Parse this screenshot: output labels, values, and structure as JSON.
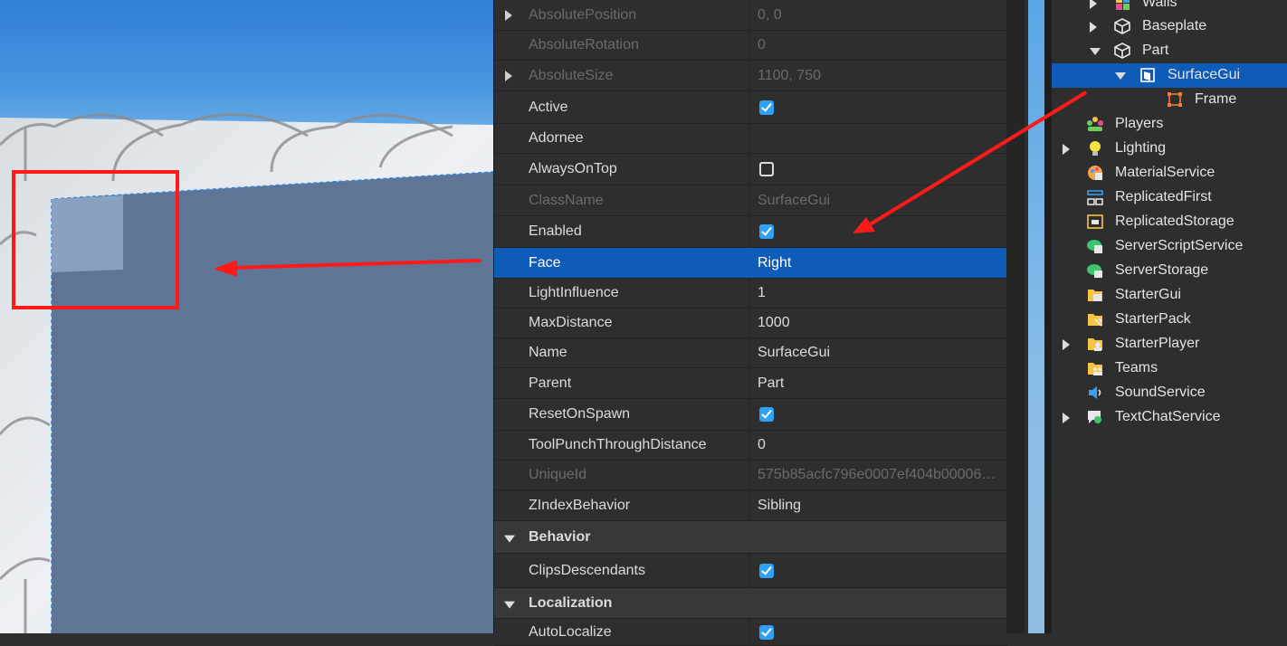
{
  "properties": {
    "rows": [
      {
        "name": "AbsolutePosition",
        "value": "0, 0",
        "style": "dim",
        "expand": true
      },
      {
        "name": "AbsoluteRotation",
        "value": "0",
        "style": "dim"
      },
      {
        "name": "AbsoluteSize",
        "value": "1100, 750",
        "style": "dim",
        "expand": true
      },
      {
        "name": "Active",
        "checkbox": true
      },
      {
        "name": "Adornee",
        "value": ""
      },
      {
        "name": "AlwaysOnTop",
        "checkbox": false
      },
      {
        "name": "ClassName",
        "value": "SurfaceGui",
        "style": "dim"
      },
      {
        "name": "Enabled",
        "checkbox": true
      },
      {
        "name": "Face",
        "value": "Right",
        "style": "selected"
      },
      {
        "name": "LightInfluence",
        "value": "1"
      },
      {
        "name": "MaxDistance",
        "value": "1000"
      },
      {
        "name": "Name",
        "value": "SurfaceGui"
      },
      {
        "name": "Parent",
        "value": "Part"
      },
      {
        "name": "ResetOnSpawn",
        "checkbox": true
      },
      {
        "name": "ToolPunchThroughDistance",
        "value": "0"
      },
      {
        "name": "UniqueId",
        "value": "575b85acfc796e0007ef404b00006…",
        "style": "dim"
      },
      {
        "name": "ZIndexBehavior",
        "value": "Sibling"
      },
      {
        "name": "Behavior",
        "category": true
      },
      {
        "name": "ClipsDescendants",
        "checkbox": true
      },
      {
        "name": "Localization",
        "category": true
      },
      {
        "name": "AutoLocalize",
        "checkbox": true
      }
    ]
  },
  "explorer": {
    "items": [
      {
        "label": "Walls",
        "icon": "model-icon",
        "indent": 1,
        "toggle": "right"
      },
      {
        "label": "Baseplate",
        "icon": "part-icon",
        "indent": 1,
        "toggle": "right"
      },
      {
        "label": "Part",
        "icon": "part-icon",
        "indent": 1,
        "toggle": "down"
      },
      {
        "label": "SurfaceGui",
        "icon": "surfacegui-icon",
        "indent": 2,
        "toggle": "down",
        "selected": true
      },
      {
        "label": "Frame",
        "icon": "frame-icon",
        "indent": 3
      },
      {
        "label": "Players",
        "icon": "players-icon",
        "indent": 0
      },
      {
        "label": "Lighting",
        "icon": "lighting-icon",
        "indent": 0,
        "toggle": "right"
      },
      {
        "label": "MaterialService",
        "icon": "materialservice-icon",
        "indent": 0
      },
      {
        "label": "ReplicatedFirst",
        "icon": "replicatedfirst-icon",
        "indent": 0
      },
      {
        "label": "ReplicatedStorage",
        "icon": "replicatedstorage-icon",
        "indent": 0
      },
      {
        "label": "ServerScriptService",
        "icon": "serverscriptservice-icon",
        "indent": 0
      },
      {
        "label": "ServerStorage",
        "icon": "serverstorage-icon",
        "indent": 0
      },
      {
        "label": "StarterGui",
        "icon": "startergui-icon",
        "indent": 0
      },
      {
        "label": "StarterPack",
        "icon": "starterpack-icon",
        "indent": 0
      },
      {
        "label": "StarterPlayer",
        "icon": "starterplayer-icon",
        "indent": 0,
        "toggle": "right"
      },
      {
        "label": "Teams",
        "icon": "teams-icon",
        "indent": 0
      },
      {
        "label": "SoundService",
        "icon": "soundservice-icon",
        "indent": 0
      },
      {
        "label": "TextChatService",
        "icon": "textchatservice-icon",
        "indent": 0,
        "toggle": "right"
      }
    ]
  },
  "colors": {
    "selection": "#0f5cb8",
    "checkbox": "#2ea2f6",
    "annotation": "#ff1a1a",
    "panel": "#2e2e2e"
  }
}
